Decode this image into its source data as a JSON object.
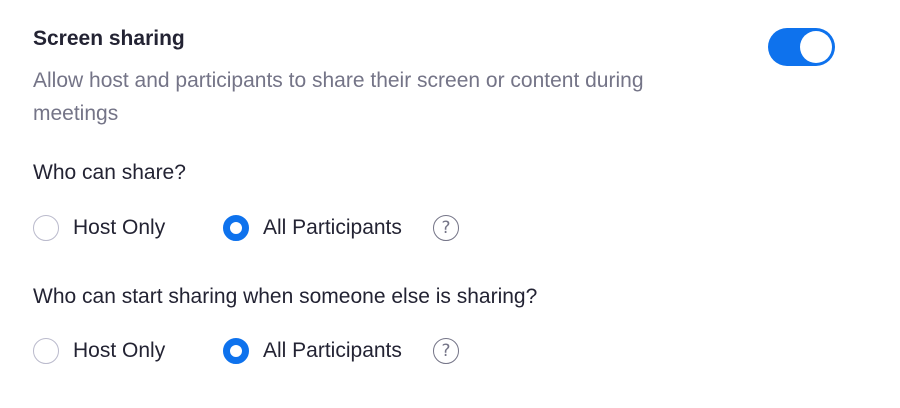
{
  "setting": {
    "title": "Screen sharing",
    "description": "Allow host and participants to share their screen or content during meetings",
    "enabled": true
  },
  "groups": [
    {
      "question": "Who can share?",
      "options": [
        {
          "label": "Host Only",
          "selected": false
        },
        {
          "label": "All Participants",
          "selected": true
        }
      ],
      "help_icon": "?"
    },
    {
      "question": "Who can start sharing when someone else is sharing?",
      "options": [
        {
          "label": "Host Only",
          "selected": false
        },
        {
          "label": "All Participants",
          "selected": true
        }
      ],
      "help_icon": "?"
    }
  ],
  "colors": {
    "accent": "#0e72ed",
    "text": "#232333",
    "muted": "#747487",
    "radio_border": "#babacc"
  },
  "icons": {
    "help": "question-circle-icon"
  }
}
